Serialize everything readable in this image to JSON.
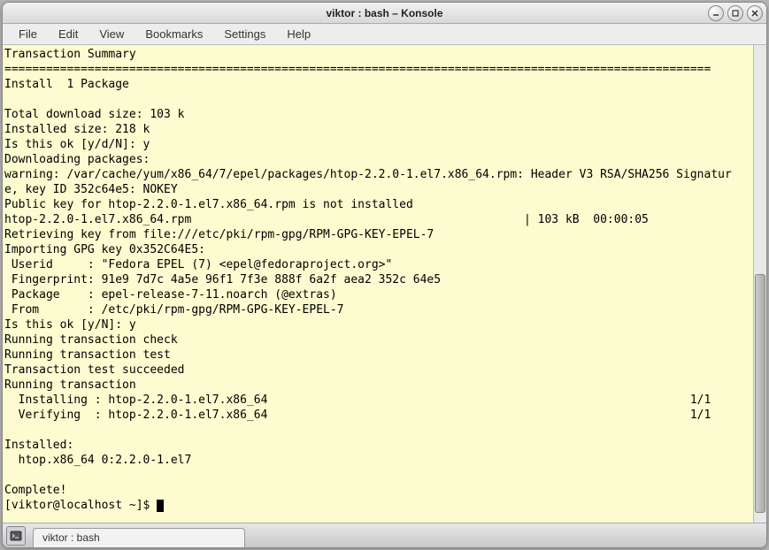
{
  "window": {
    "title": "viktor : bash – Konsole"
  },
  "menubar": {
    "items": [
      "File",
      "Edit",
      "View",
      "Bookmarks",
      "Settings",
      "Help"
    ]
  },
  "terminal": {
    "lines": [
      "Transaction Summary",
      "======================================================================================================",
      "Install  1 Package",
      "",
      "Total download size: 103 k",
      "Installed size: 218 k",
      "Is this ok [y/d/N]: y",
      "Downloading packages:",
      "warning: /var/cache/yum/x86_64/7/epel/packages/htop-2.2.0-1.el7.x86_64.rpm: Header V3 RSA/SHA256 Signatur",
      "e, key ID 352c64e5: NOKEY",
      "Public key for htop-2.2.0-1.el7.x86_64.rpm is not installed",
      "htop-2.2.0-1.el7.x86_64.rpm                                                | 103 kB  00:00:05",
      "Retrieving key from file:///etc/pki/rpm-gpg/RPM-GPG-KEY-EPEL-7",
      "Importing GPG key 0x352C64E5:",
      " Userid     : \"Fedora EPEL (7) <epel@fedoraproject.org>\"",
      " Fingerprint: 91e9 7d7c 4a5e 96f1 7f3e 888f 6a2f aea2 352c 64e5",
      " Package    : epel-release-7-11.noarch (@extras)",
      " From       : /etc/pki/rpm-gpg/RPM-GPG-KEY-EPEL-7",
      "Is this ok [y/N]: y",
      "Running transaction check",
      "Running transaction test",
      "Transaction test succeeded",
      "Running transaction",
      "  Installing : htop-2.2.0-1.el7.x86_64                                                             1/1",
      "  Verifying  : htop-2.2.0-1.el7.x86_64                                                             1/1",
      "",
      "Installed:",
      "  htop.x86_64 0:2.2.0-1.el7",
      "",
      "Complete!"
    ],
    "prompt": "[viktor@localhost ~]$ "
  },
  "taskbar": {
    "tab_label": "viktor : bash"
  }
}
